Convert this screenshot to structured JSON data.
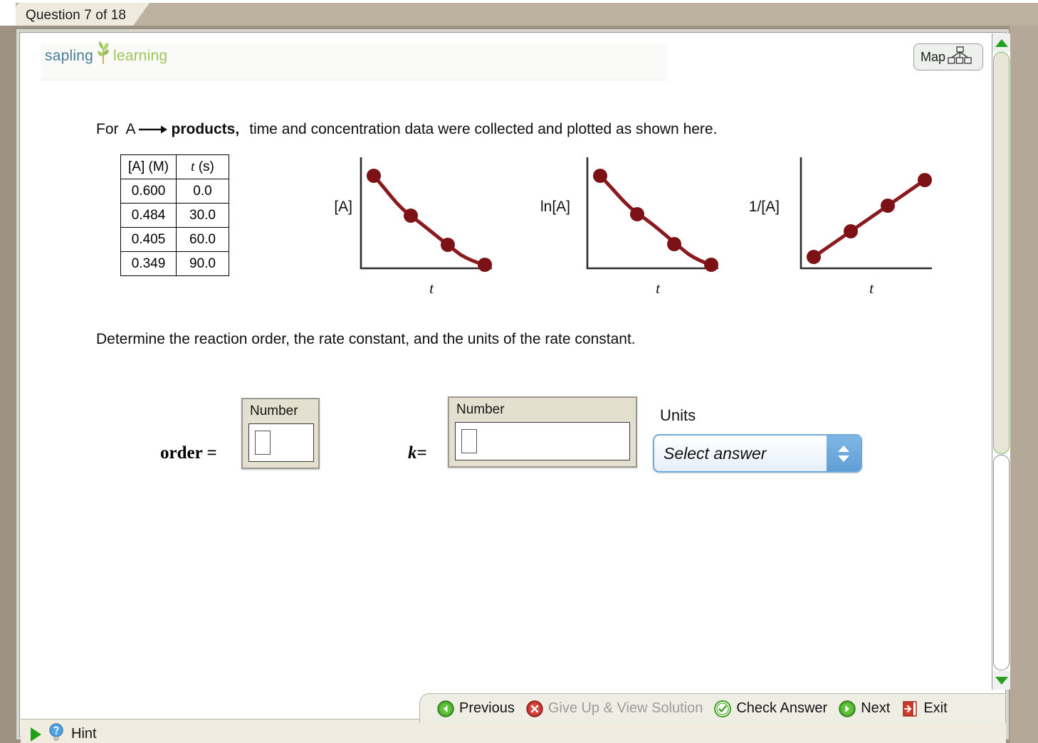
{
  "tab": {
    "label": "Question 7 of 18"
  },
  "brand": {
    "word1": "sapling",
    "word2": "learning",
    "icon": "sapling-plant-icon"
  },
  "map_button": {
    "label": "Map",
    "icon": "site-map-icon"
  },
  "question": {
    "line1_for": "For",
    "line1_reactant": "A",
    "line1_arrow": "⟶",
    "line1_products": "products,",
    "line1_rest": "time and concentration data were collected and plotted as shown here.",
    "line2": "Determine the reaction order, the rate constant, and the units of the rate constant."
  },
  "table": {
    "headers": [
      "[A] (M)",
      "t (s)"
    ],
    "header_italic_parts": [
      "",
      "t"
    ],
    "rows": [
      [
        "0.600",
        "0.0"
      ],
      [
        "0.484",
        "30.0"
      ],
      [
        "0.405",
        "60.0"
      ],
      [
        "0.349",
        "90.0"
      ]
    ]
  },
  "chart_data": [
    {
      "type": "line",
      "title": "",
      "ylabel": "[A]",
      "xlabel": "t",
      "x": [
        0.0,
        30.0,
        60.0,
        90.0
      ],
      "values": [
        0.6,
        0.484,
        0.405,
        0.349
      ],
      "grid": false,
      "legend": "none",
      "shape": "convex-decreasing",
      "marker_color": "#7d1216",
      "line_color": "#8b1a1e"
    },
    {
      "type": "line",
      "title": "",
      "ylabel": "ln[A]",
      "xlabel": "t",
      "x": [
        0.0,
        30.0,
        60.0,
        90.0
      ],
      "values": [
        -0.511,
        -0.726,
        -0.904,
        -1.053
      ],
      "grid": false,
      "legend": "none",
      "shape": "convex-decreasing",
      "marker_color": "#7d1216",
      "line_color": "#8b1a1e"
    },
    {
      "type": "line",
      "title": "",
      "ylabel": "1/[A]",
      "xlabel": "t",
      "x": [
        0.0,
        30.0,
        60.0,
        90.0
      ],
      "values": [
        1.667,
        2.066,
        2.469,
        2.865
      ],
      "grid": false,
      "legend": "none",
      "shape": "linear-increasing",
      "marker_color": "#7d1216",
      "line_color": "#8b1a1e"
    }
  ],
  "answers": {
    "order": {
      "equals_label": "order =",
      "caption": "Number",
      "value": ""
    },
    "k": {
      "equals_label_var": "k",
      "equals_sign": "=",
      "caption": "Number",
      "value": ""
    },
    "units": {
      "label": "Units",
      "selected": "Select answer"
    }
  },
  "nav": {
    "previous": "Previous",
    "give_up": "Give Up & View Solution",
    "check_answer": "Check Answer",
    "next": "Next",
    "exit": "Exit"
  },
  "hint": {
    "label": "Hint"
  }
}
